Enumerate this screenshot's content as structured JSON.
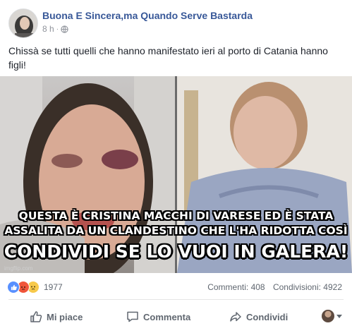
{
  "post": {
    "page_name": "Buona E Sincera,ma Quando Serve Bastarda",
    "time": "8 h",
    "privacy_icon": "globe-icon",
    "caption": "Chissà se tutti quelli che hanno manifestato ieri al porto di Catania hanno figli!",
    "image": {
      "overlay_line1": "QUESTA È CRISTINA MACCHI DI VARESE ED È STATA",
      "overlay_line2": "ASSALITA DA UN CLANDESTINO CHE L'HA RIDOTTA COSÌ",
      "overlay_line3": "CONDIVIDI SE LO VUOI IN GALERA!",
      "watermark": "imgflip.com"
    },
    "reactions": {
      "icons": [
        "like-icon",
        "angry-icon",
        "sad-icon"
      ],
      "count": "1977",
      "comments": "Commenti: 408",
      "shares": "Condivisioni: 4922"
    },
    "actions": {
      "like": "Mi piace",
      "comment": "Commenta",
      "share": "Condividi"
    }
  }
}
